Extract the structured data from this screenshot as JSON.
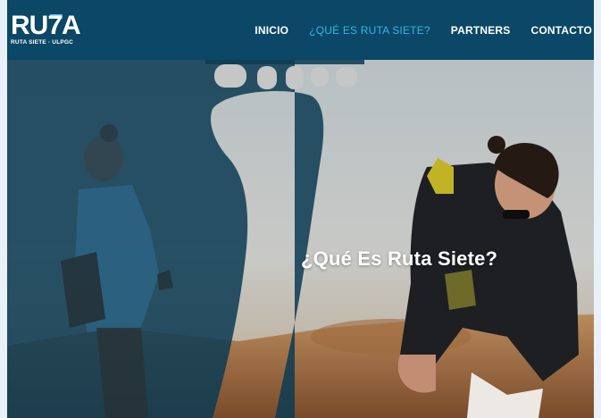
{
  "brand": {
    "logo_text": "RU7A",
    "logo_subtitle": "RUTA SIETE · ULPGC"
  },
  "nav": {
    "items": [
      {
        "label": "INICIO",
        "active": false
      },
      {
        "label": "¿QUÉ ES RUTA SIETE?",
        "active": true
      },
      {
        "label": "PARTNERS",
        "active": false
      },
      {
        "label": "CONTACTO",
        "active": false
      }
    ],
    "active_color": "#33b6e4"
  },
  "hero": {
    "title": "¿Qué Es Ruta Siete?",
    "overlay_icon": "footprint-icon"
  },
  "colors": {
    "navbar_bg": "#0b4766",
    "overlay_dark": "#0d3b53",
    "page_bg": "#e8f1f7"
  }
}
